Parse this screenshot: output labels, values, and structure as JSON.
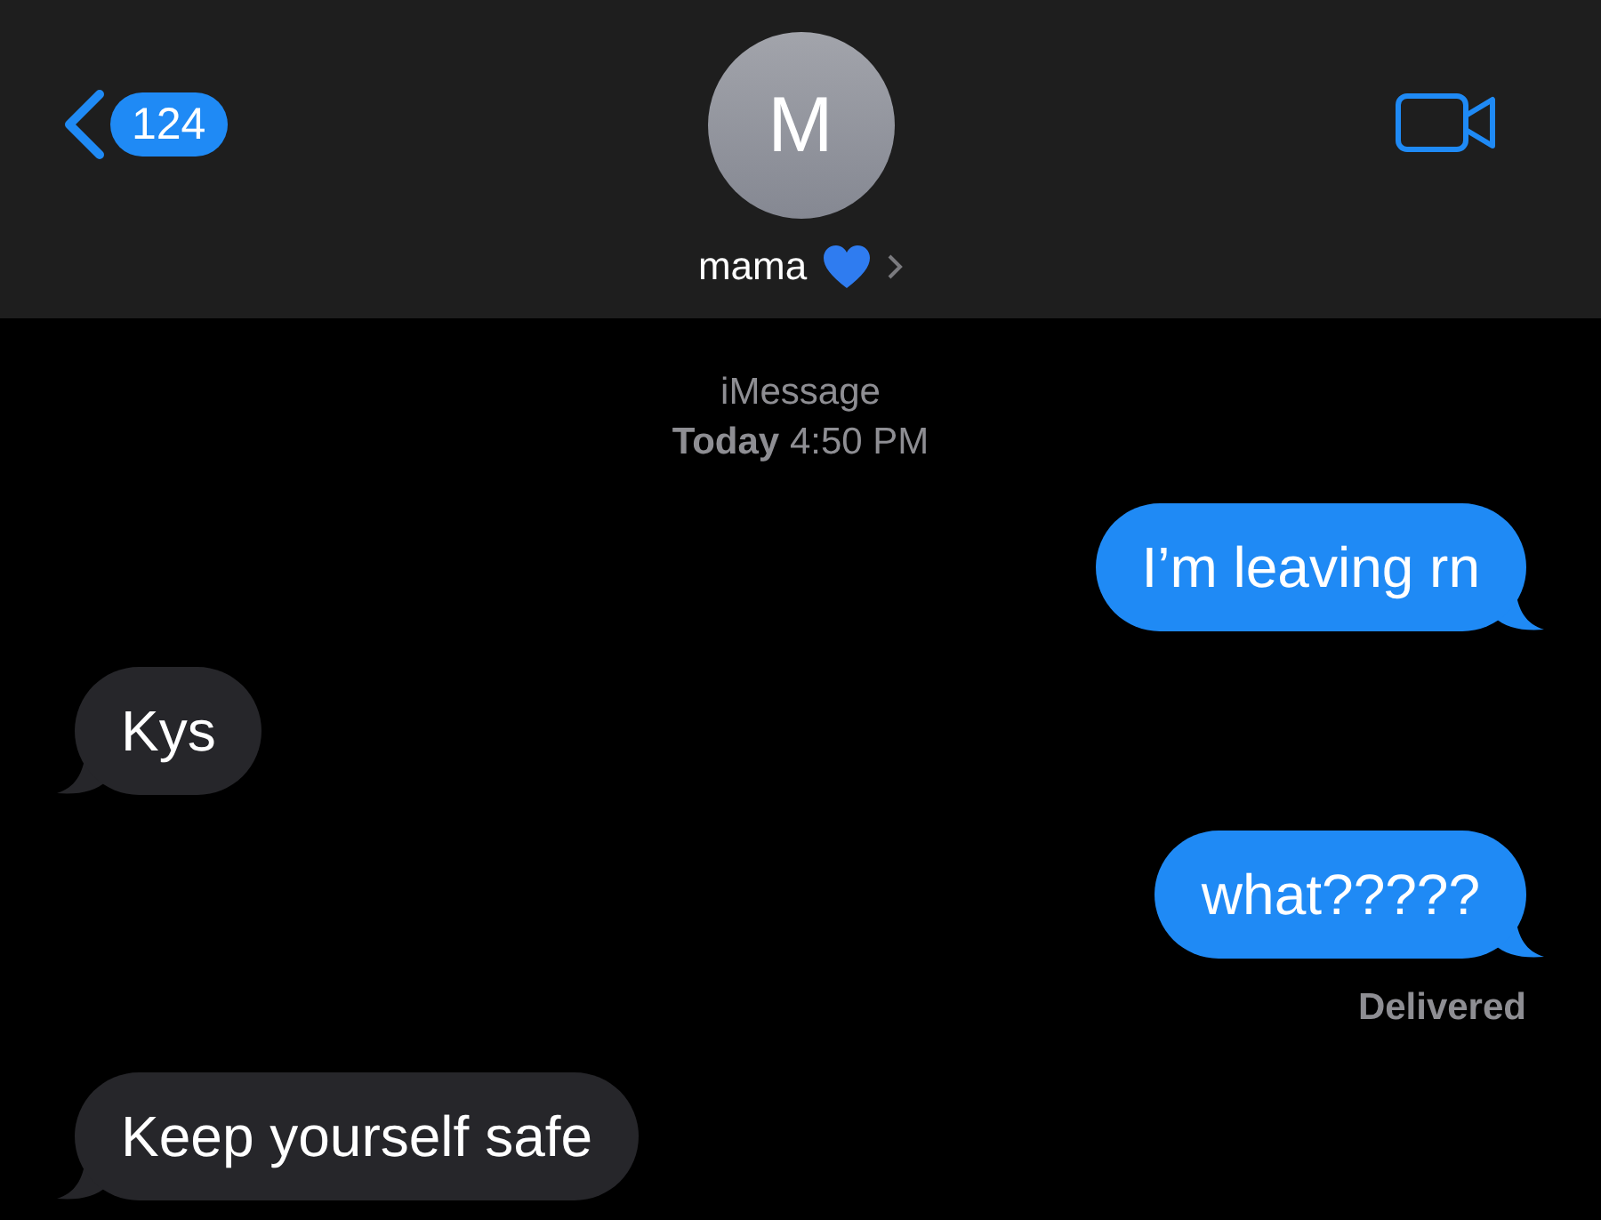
{
  "header": {
    "back_badge": "124",
    "avatar_initial": "M",
    "contact_name": "mama"
  },
  "conversation": {
    "service": "iMessage",
    "timestamp": "**Today** 4:50 PM"
  },
  "messages": [
    {
      "kind": "sent",
      "text": "I’m leaving rn"
    },
    {
      "kind": "received",
      "text": "Kys"
    },
    {
      "kind": "sent",
      "text": "what?????",
      "status": "Delivered"
    },
    {
      "kind": "received",
      "text": "Keep yourself safe"
    }
  ]
}
